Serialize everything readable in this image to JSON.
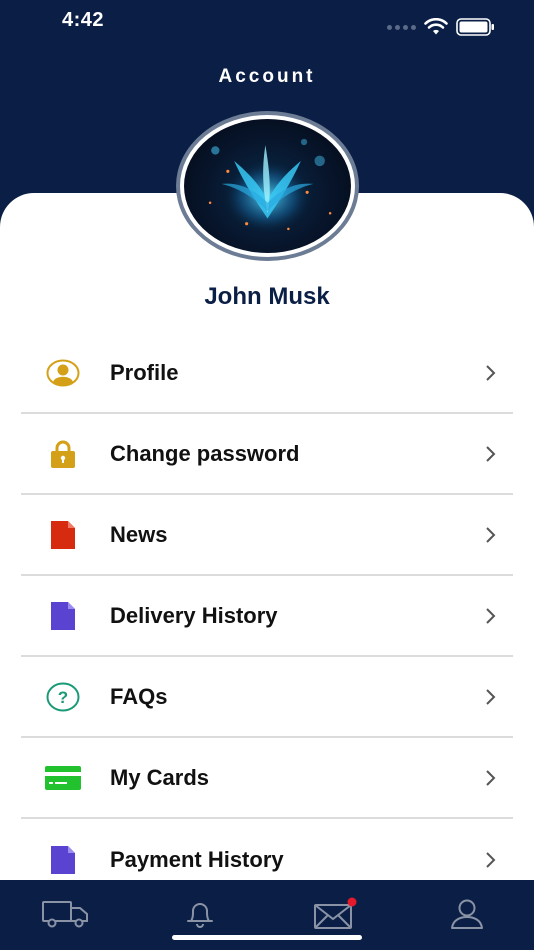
{
  "status_bar": {
    "time": "4:42"
  },
  "header": {
    "title": "Account"
  },
  "user": {
    "name": "John Musk"
  },
  "menu": {
    "items": [
      {
        "label": "Profile",
        "icon": "user-circle-icon",
        "color": "#d4a017"
      },
      {
        "label": "Change password",
        "icon": "lock-icon",
        "color": "#d4a017"
      },
      {
        "label": "News",
        "icon": "document-icon",
        "color": "#d62b0f"
      },
      {
        "label": "Delivery History",
        "icon": "document-icon",
        "color": "#5b43d1"
      },
      {
        "label": "FAQs",
        "icon": "question-circle-icon",
        "color": "#1a9a77"
      },
      {
        "label": "My Cards",
        "icon": "credit-card-icon",
        "color": "#22c22e"
      },
      {
        "label": "Payment History",
        "icon": "document-icon",
        "color": "#5b43d1"
      }
    ]
  },
  "tabbar": {
    "tabs": [
      {
        "icon": "truck-icon"
      },
      {
        "icon": "bell-icon"
      },
      {
        "icon": "mail-icon",
        "badge": true
      },
      {
        "icon": "person-icon"
      }
    ]
  },
  "colors": {
    "header_bg": "#0b1f46",
    "accent_name": "#0b1f46",
    "badge": "#e5192b"
  }
}
